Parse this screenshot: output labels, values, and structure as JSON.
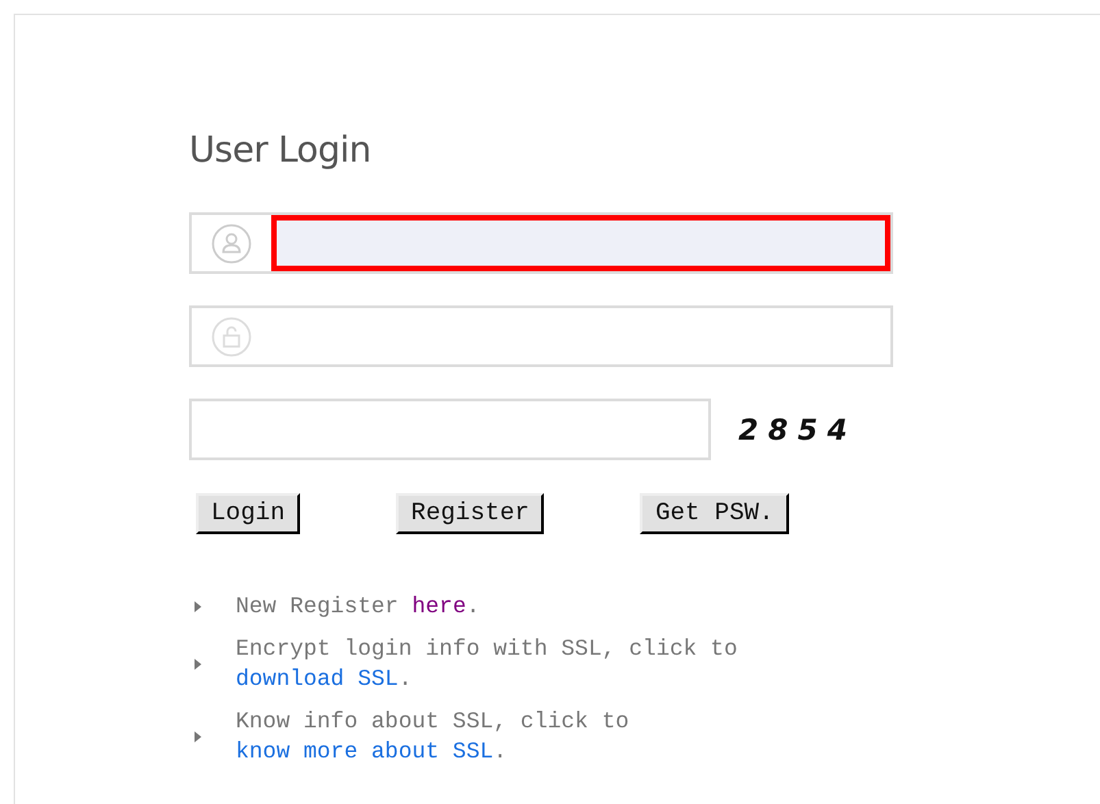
{
  "title": "User Login",
  "fields": [
    {
      "kind": "user",
      "focused": true
    },
    {
      "kind": "password",
      "focused": false
    },
    {
      "kind": "captcha",
      "focused": false,
      "captcha": "2854"
    }
  ],
  "buttons": [
    "Login",
    "Register",
    "Get PSW."
  ],
  "notes": [
    [
      {
        "kind": "text",
        "text": "New Register "
      },
      {
        "kind": "link",
        "text": "here",
        "visited": true
      },
      {
        "kind": "text",
        "text": "."
      }
    ],
    [
      {
        "kind": "text",
        "text": "Encrypt login info with SSL, click to "
      },
      {
        "kind": "link",
        "text": "download SSL",
        "visited": false
      },
      {
        "kind": "text",
        "text": "."
      }
    ],
    [
      {
        "kind": "text",
        "text": "Know info about SSL, click to "
      },
      {
        "kind": "link",
        "text": "know more about SSL",
        "visited": false
      },
      {
        "kind": "text",
        "text": "."
      }
    ]
  ]
}
